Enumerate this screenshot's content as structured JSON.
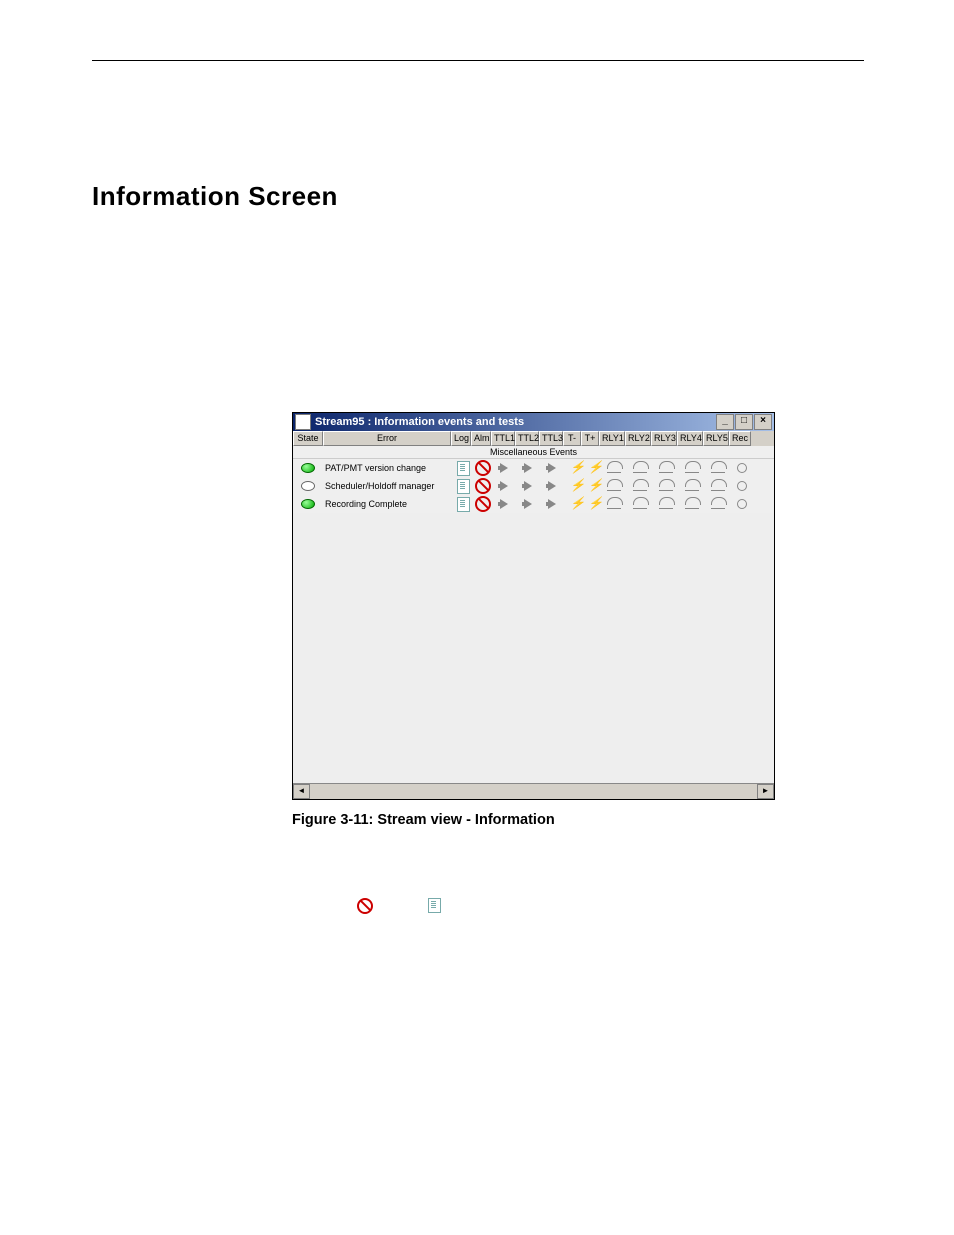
{
  "heading": "Information Screen",
  "window_title": "Stream95 : Information events and tests",
  "columns": {
    "state": "State",
    "error": "Error",
    "log": "Log",
    "alm": "Alm",
    "ttl1": "TTL1",
    "ttl2": "TTL2",
    "ttl3": "TTL3",
    "tminus": "T-",
    "tplus": "T+",
    "rly1": "RLY1",
    "rly2": "RLY2",
    "rly3": "RLY3",
    "rly4": "RLY4",
    "rly5": "RLY5",
    "rec": "Rec"
  },
  "subhead": "Miscellaneous Events",
  "rows": [
    {
      "state": "green",
      "error": "PAT/PMT version change"
    },
    {
      "state": "gray",
      "error": "Scheduler/Holdoff manager"
    },
    {
      "state": "green",
      "error": "Recording Complete"
    }
  ],
  "caption": "Figure 3-11: Stream view - Information",
  "win_btns": {
    "min": "_",
    "max": "□",
    "close": "×"
  }
}
